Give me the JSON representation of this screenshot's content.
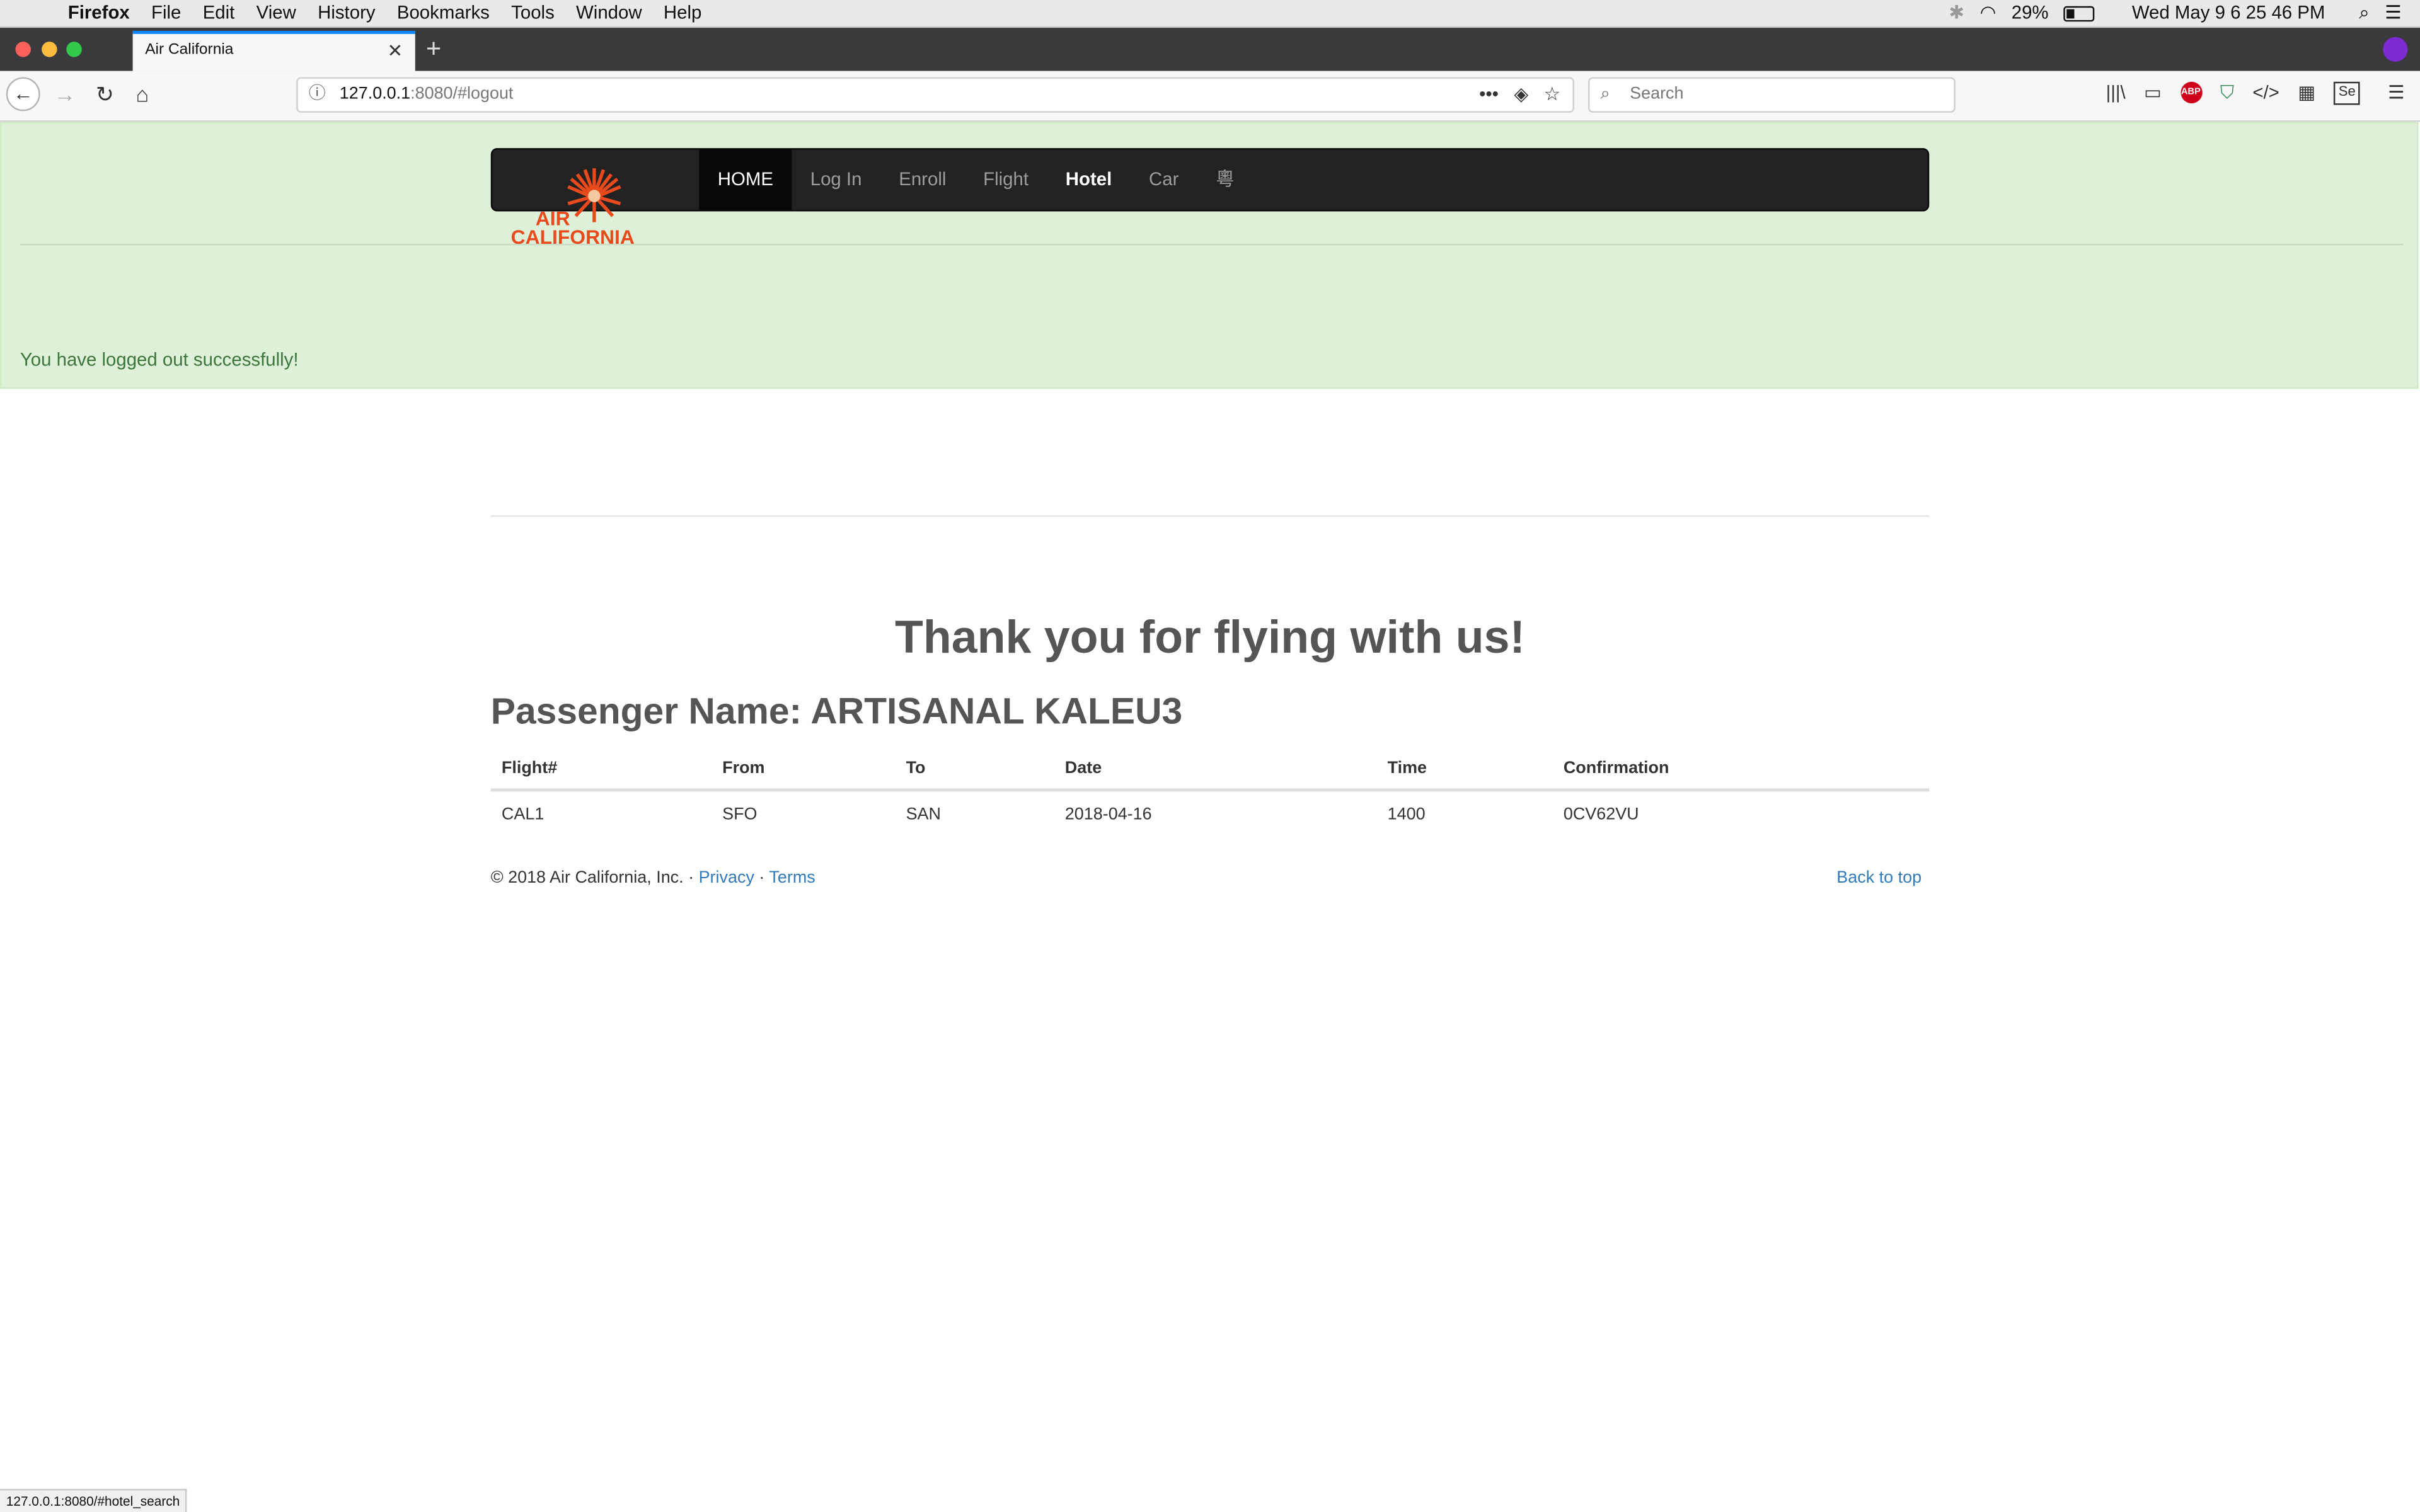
{
  "menubar": {
    "app": "Firefox",
    "menus": [
      "File",
      "Edit",
      "View",
      "History",
      "Bookmarks",
      "Tools",
      "Window",
      "Help"
    ],
    "battery": "29%",
    "datetime": "Wed May 9  6 25 46 PM"
  },
  "browser": {
    "tab_title": "Air California",
    "url_host": "127.0.0.1",
    "url_path": ":8080/#logout",
    "search_placeholder": "Search",
    "status_url": "127.0.0.1:8080/#hotel_search"
  },
  "alert": {
    "message": "You have logged out successfully!"
  },
  "navbar": {
    "brand": [
      "AIR",
      "CALIFORNIA"
    ],
    "links": [
      {
        "label": "HOME"
      },
      {
        "label": "Log In"
      },
      {
        "label": "Enroll"
      },
      {
        "label": "Flight"
      },
      {
        "label": "Hotel"
      },
      {
        "label": "Car"
      },
      {
        "label": "粵"
      }
    ]
  },
  "main": {
    "heading": "Thank you for flying with us!",
    "passenger": "Passenger Name: ARTISANAL KALEU3",
    "table": {
      "headers": [
        "Flight#",
        "From",
        "To",
        "Date",
        "Time",
        "Confirmation"
      ],
      "rows": [
        [
          "CAL1",
          "SFO",
          "SAN",
          "2018-04-16",
          "1400",
          "0CV62VU"
        ]
      ]
    }
  },
  "footer": {
    "copyright": "© 2018 Air California, Inc. ·",
    "privacy": "Privacy",
    "sep": "·",
    "terms": "Terms",
    "back_to_top": "Back to top"
  },
  "colors": {
    "alert_bg": "#dff0d8",
    "alert_text": "#3c763d",
    "navbar_bg": "#222222",
    "brand": "#e8491d",
    "link": "#337ab7"
  }
}
